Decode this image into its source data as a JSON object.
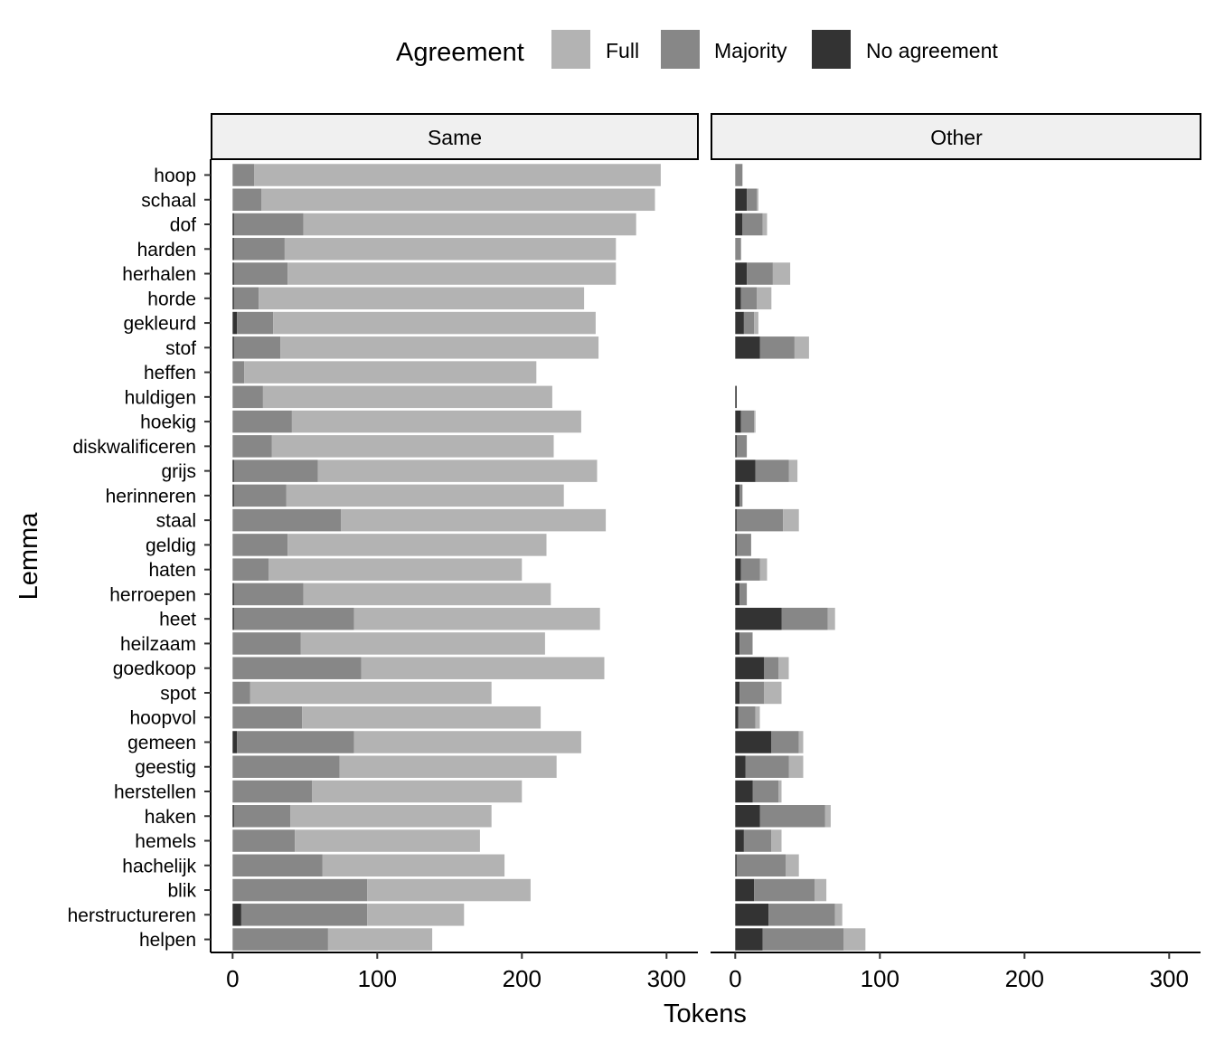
{
  "chart_data": {
    "type": "bar",
    "orientation": "horizontal",
    "stacked": true,
    "title": "",
    "xlabel": "Tokens",
    "ylabel": "Lemma",
    "xlim": [
      0,
      320
    ],
    "xticks": [
      0,
      100,
      200,
      300
    ],
    "grid": false,
    "legend": {
      "title": "Agreement",
      "position": "top",
      "entries": [
        {
          "name": "Full",
          "color": "#b3b3b3"
        },
        {
          "name": "Majority",
          "color": "#878787"
        },
        {
          "name": "No agreement",
          "color": "#333333"
        }
      ]
    },
    "categories": [
      "hoop",
      "schaal",
      "dof",
      "harden",
      "herhalen",
      "horde",
      "gekleurd",
      "stof",
      "heffen",
      "huldigen",
      "hoekig",
      "diskwalificeren",
      "grijs",
      "herinneren",
      "staal",
      "geldig",
      "haten",
      "herroepen",
      "heet",
      "heilzaam",
      "goedkoop",
      "spot",
      "hoopvol",
      "gemeen",
      "geestig",
      "herstellen",
      "haken",
      "hemels",
      "hachelijk",
      "blik",
      "herstructureren",
      "helpen"
    ],
    "stack_order": [
      "No agreement",
      "Majority",
      "Full"
    ],
    "facets": [
      {
        "name": "Same",
        "series": [
          {
            "name": "No agreement",
            "values": [
              0,
              0,
              1,
              1,
              1,
              1,
              3,
              1,
              0,
              0,
              0,
              0,
              1,
              1,
              0,
              0,
              0,
              1,
              1,
              0,
              0,
              0,
              0,
              3,
              0,
              0,
              1,
              0,
              0,
              0,
              6,
              0
            ]
          },
          {
            "name": "Majority",
            "values": [
              15,
              20,
              48,
              35,
              37,
              17,
              25,
              32,
              8,
              21,
              41,
              27,
              58,
              36,
              75,
              38,
              25,
              48,
              83,
              47,
              89,
              12,
              48,
              81,
              74,
              55,
              39,
              43,
              62,
              93,
              87,
              66
            ]
          },
          {
            "name": "Full",
            "values": [
              281,
              272,
              230,
              229,
              227,
              225,
              223,
              220,
              202,
              200,
              200,
              195,
              193,
              192,
              183,
              179,
              175,
              171,
              170,
              169,
              168,
              167,
              165,
              157,
              150,
              145,
              139,
              128,
              126,
              113,
              67,
              72
            ]
          }
        ]
      },
      {
        "name": "Other",
        "series": [
          {
            "name": "No agreement",
            "values": [
              0,
              8,
              5,
              0,
              8,
              4,
              6,
              17,
              0,
              1,
              4,
              1,
              14,
              3,
              1,
              1,
              4,
              3,
              32,
              3,
              20,
              3,
              2,
              25,
              7,
              12,
              17,
              6,
              1,
              13,
              23,
              19
            ]
          },
          {
            "name": "Majority",
            "values": [
              5,
              7,
              14,
              4,
              18,
              11,
              7,
              24,
              0,
              0,
              9,
              7,
              23,
              2,
              32,
              10,
              13,
              5,
              32,
              9,
              10,
              17,
              12,
              19,
              30,
              18,
              45,
              19,
              34,
              42,
              46,
              56
            ]
          },
          {
            "name": "Full",
            "values": [
              0,
              1,
              3,
              0,
              12,
              10,
              3,
              10,
              0,
              0,
              1,
              0,
              6,
              0,
              11,
              0,
              5,
              0,
              5,
              0,
              7,
              12,
              3,
              3,
              10,
              2,
              4,
              7,
              9,
              8,
              5,
              15
            ]
          }
        ]
      }
    ]
  }
}
